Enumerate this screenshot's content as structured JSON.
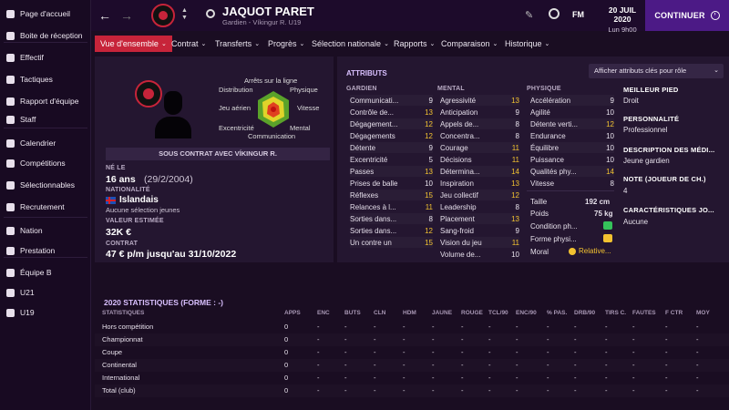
{
  "sidebar": {
    "items": [
      {
        "label": "Page d'accueil",
        "icon": "home-icon"
      },
      {
        "label": "Boite de réception",
        "icon": "inbox-icon"
      },
      {
        "label": "Effectif",
        "icon": "shirt-icon"
      },
      {
        "label": "Tactiques",
        "icon": "tactics-icon"
      },
      {
        "label": "Rapport d'équipe",
        "icon": "report-icon"
      },
      {
        "label": "Staff",
        "icon": "staff-icon"
      },
      {
        "label": "Calendrier",
        "icon": "calendar-icon"
      },
      {
        "label": "Compétitions",
        "icon": "trophy-icon"
      },
      {
        "label": "Sélectionnables",
        "icon": "list-icon"
      },
      {
        "label": "Recrutement",
        "icon": "scout-icon"
      },
      {
        "label": "Nation",
        "icon": "shield-icon"
      },
      {
        "label": "Prestation",
        "icon": "handshake-icon"
      },
      {
        "label": "Équipe B",
        "icon": "team-icon"
      },
      {
        "label": "U21",
        "icon": "team-u21-icon"
      },
      {
        "label": "U19",
        "icon": "team-u19-icon"
      }
    ]
  },
  "header": {
    "player_name": "JAQUOT PARET",
    "subtitle": "Gardien - Víkingur R. U19",
    "date": "20 JUIL 2020",
    "day": "Lun 9h00",
    "fm": "FM",
    "continue": "CONTINUER"
  },
  "tabs": [
    {
      "label": "Vue d'ensemble"
    },
    {
      "label": "Contrat"
    },
    {
      "label": "Transferts"
    },
    {
      "label": "Progrès"
    },
    {
      "label": "Sélection nationale"
    },
    {
      "label": "Rapports"
    },
    {
      "label": "Comparaison"
    },
    {
      "label": "Historique"
    }
  ],
  "profile": {
    "radar_labels": {
      "top": "Arrêts sur la ligne",
      "tl": "Distribution",
      "tr": "Physique",
      "l": "Jeu aérien",
      "r": "Vitesse",
      "bl": "Excentricité",
      "br": "Mental",
      "b": "Communication"
    },
    "contract_banner": "SOUS CONTRAT AVEC VÍKINGUR R.",
    "born_label": "NÉ LE",
    "age": "16 ans",
    "dob": "(29/2/2004)",
    "nationality_label": "NATIONALITÉ",
    "nationality": "Islandais",
    "selection": "Aucune sélection jeunes",
    "value_label": "VALEUR ESTIMÉE",
    "value": "32K €",
    "contract_label": "CONTRAT",
    "contract": "47 € p/m jusqu'au 31/10/2022"
  },
  "attributes": {
    "title": "ATTRIBUTS",
    "dropdown": "Afficher attributs clés pour rôle",
    "gk_label": "GARDIEN",
    "mental_label": "MENTAL",
    "phys_label": "PHYSIQUE",
    "gk": [
      [
        "Communicati...",
        "9"
      ],
      [
        "Contrôle de...",
        "13"
      ],
      [
        "Dégagement...",
        "12"
      ],
      [
        "Dégagements",
        "12"
      ],
      [
        "Détente",
        "9"
      ],
      [
        "Excentricité",
        "5"
      ],
      [
        "Passes",
        "13"
      ],
      [
        "Prises de balle",
        "10"
      ],
      [
        "Réflexes",
        "15"
      ],
      [
        "Relances à l...",
        "11"
      ],
      [
        "Sorties dans...",
        "8"
      ],
      [
        "Sorties dans...",
        "12"
      ],
      [
        "Un contre un",
        "15"
      ]
    ],
    "mental": [
      [
        "Agressivité",
        "13"
      ],
      [
        "Anticipation",
        "9"
      ],
      [
        "Appels de...",
        "8"
      ],
      [
        "Concentra...",
        "8"
      ],
      [
        "Courage",
        "11"
      ],
      [
        "Décisions",
        "11"
      ],
      [
        "Détermina...",
        "14"
      ],
      [
        "Inspiration",
        "13"
      ],
      [
        "Jeu collectif",
        "12"
      ],
      [
        "Leadership",
        "8"
      ],
      [
        "Placement",
        "13"
      ],
      [
        "Sang-froid",
        "9"
      ],
      [
        "Vision du jeu",
        "11"
      ],
      [
        "Volume de...",
        "10"
      ]
    ],
    "physical": [
      [
        "Accélération",
        "9"
      ],
      [
        "Agilité",
        "10"
      ],
      [
        "Détente verti...",
        "12"
      ],
      [
        "Endurance",
        "10"
      ],
      [
        "Équilibre",
        "10"
      ],
      [
        "Puissance",
        "10"
      ],
      [
        "Qualités phy...",
        "14"
      ],
      [
        "Vitesse",
        "8"
      ]
    ],
    "height_label": "Taille",
    "height": "192 cm",
    "weight_label": "Poids",
    "weight": "75 kg",
    "condition_label": "Condition ph...",
    "form_label": "Forme physi...",
    "morale_label": "Moral",
    "morale": "Relative..."
  },
  "info": {
    "foot_label": "MEILLEUR PIED",
    "foot": "Droit",
    "personality_label": "PERSONNALITÉ",
    "personality": "Professionnel",
    "media_label": "DESCRIPTION DES MÉDI...",
    "media": "Jeune gardien",
    "rating_label": "NOTE (JOUEUR DE CH.)",
    "rating": "4",
    "traits_label": "CARACTÉRISTIQUES JO...",
    "traits": "Aucune"
  },
  "stats": {
    "title": "2020 STATISTIQUES (FORME : -)",
    "headers": [
      "STATISTIQUES",
      "APPS",
      "ENC",
      "BUTS",
      "CLN",
      "HDM",
      "JAUNE",
      "ROUGE",
      "TCL/90",
      "ENC/90",
      "% PAS.",
      "DRB/90",
      "TIRS C.",
      "FAUTES",
      "F CTR",
      "MOY"
    ],
    "rows": [
      [
        "Hors compétition",
        "0",
        "-",
        "-",
        "-",
        "-",
        "-",
        "-",
        "-",
        "-",
        "-",
        "-",
        "-",
        "-",
        "-",
        "-"
      ],
      [
        "Championnat",
        "0",
        "-",
        "-",
        "-",
        "-",
        "-",
        "-",
        "-",
        "-",
        "-",
        "-",
        "-",
        "-",
        "-",
        "-"
      ],
      [
        "Coupe",
        "0",
        "-",
        "-",
        "-",
        "-",
        "-",
        "-",
        "-",
        "-",
        "-",
        "-",
        "-",
        "-",
        "-",
        "-"
      ],
      [
        "Continental",
        "0",
        "-",
        "-",
        "-",
        "-",
        "-",
        "-",
        "-",
        "-",
        "-",
        "-",
        "-",
        "-",
        "-",
        "-"
      ],
      [
        "International",
        "0",
        "-",
        "-",
        "-",
        "-",
        "-",
        "-",
        "-",
        "-",
        "-",
        "-",
        "-",
        "-",
        "-",
        "-"
      ],
      [
        "Total (club)",
        "0",
        "-",
        "-",
        "-",
        "-",
        "-",
        "-",
        "-",
        "-",
        "-",
        "-",
        "-",
        "-",
        "-",
        "-"
      ]
    ]
  },
  "colors": {
    "accent": "#c7243a",
    "continue": "#4c1a86",
    "highlight": "#f2c230"
  }
}
